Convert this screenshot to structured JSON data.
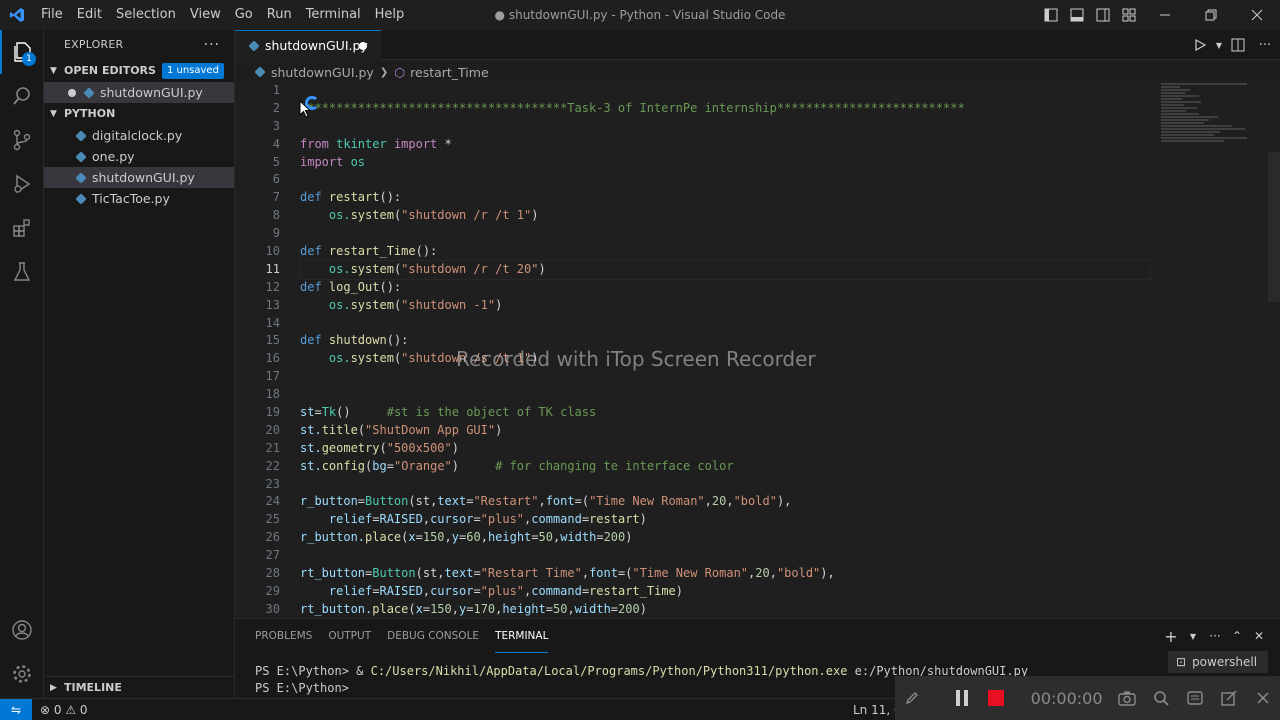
{
  "window": {
    "title": "● shutdownGUI.py - Python - Visual Studio Code",
    "menu": [
      "File",
      "Edit",
      "Selection",
      "View",
      "Go",
      "Run",
      "Terminal",
      "Help"
    ]
  },
  "activity_bar": {
    "items": [
      "explorer-icon",
      "search-icon",
      "source-control-icon",
      "run-debug-icon",
      "extensions-icon",
      "testing-icon"
    ],
    "bottom": [
      "account-icon",
      "settings-gear-icon"
    ],
    "explorer_badge": "1"
  },
  "sidebar": {
    "title": "EXPLORER",
    "more": "···",
    "open_editors": {
      "label": "OPEN EDITORS",
      "badge": "1 unsaved",
      "files": [
        "shutdownGUI.py"
      ]
    },
    "folder": {
      "label": "PYTHON",
      "files": [
        "digitalclock.py",
        "one.py",
        "shutdownGUI.py",
        "TicTacToe.py"
      ]
    },
    "timeline": "TIMELINE"
  },
  "editor": {
    "tab": "shutdownGUI.py",
    "breadcrumb": [
      "shutdownGUI.py",
      "restart_Time"
    ],
    "line_numbers": [
      "1",
      "2",
      "3",
      "4",
      "5",
      "6",
      "7",
      "8",
      "9",
      "10",
      "11",
      "12",
      "13",
      "14",
      "15",
      "16",
      "17",
      "18",
      "19",
      "20",
      "21",
      "22",
      "23",
      "24",
      "25",
      "26",
      "27",
      "28",
      "29",
      "30"
    ],
    "current_line": "11",
    "code": {
      "l2": "*************************************Task-3 of InternPe internship**************************",
      "l4a": "from",
      "l4b": " tkinter ",
      "l4c": "import",
      "l4d": " *",
      "l5a": "import",
      "l5b": " os",
      "l7a": "def",
      "l7b": " restart",
      "l7c": "():",
      "l8a": "    os.",
      "l8b": "system",
      "l8c": "(",
      "l8d": "\"shutdown /r /t 1\"",
      "l8e": ")",
      "l10a": "def",
      "l10b": " restart_Time",
      "l10c": "():",
      "l11a": "    os.",
      "l11b": "system",
      "l11c": "(",
      "l11d": "\"shutdown /r /t 20\"",
      "l11e": ")",
      "l12a": "def",
      "l12b": " log_Out",
      "l12c": "():",
      "l13a": "    os.",
      "l13b": "system",
      "l13c": "(",
      "l13d": "\"shutdown -1\"",
      "l13e": ")",
      "l15a": "def",
      "l15b": " shutdown",
      "l15c": "():",
      "l16a": "    os.",
      "l16b": "system",
      "l16c": "(",
      "l16d": "\"shutdown /s /t 1\"",
      "l16e": ")",
      "l19a": "st",
      "l19b": "=",
      "l19c": "Tk",
      "l19d": "()     ",
      "l19e": "#st is the object of TK class",
      "l20a": "st.",
      "l20b": "title",
      "l20c": "(",
      "l20d": "\"ShutDown App GUI\"",
      "l20e": ")",
      "l21a": "st.",
      "l21b": "geometry",
      "l21c": "(",
      "l21d": "\"500x500\"",
      "l21e": ")",
      "l22a": "st.",
      "l22b": "config",
      "l22c": "(",
      "l22d": "bg",
      "l22e": "=",
      "l22f": "\"Orange\"",
      "l22g": ")     ",
      "l22h": "# for changing te interface color",
      "l24a": "r_button",
      "l24b": "=",
      "l24c": "Button",
      "l24d": "(st,",
      "l24e": "text",
      "l24f": "=",
      "l24g": "\"Restart\"",
      "l24h": ",",
      "l24i": "font",
      "l24j": "=(",
      "l24k": "\"Time New Roman\"",
      "l24l": ",",
      "l24m": "20",
      "l24n": ",",
      "l24o": "\"bold\"",
      "l24p": "),",
      "l25a": "    relief",
      "l25b": "=",
      "l25c": "RAISED",
      "l25d": ",",
      "l25e": "cursor",
      "l25f": "=",
      "l25g": "\"plus\"",
      "l25h": ",",
      "l25i": "command",
      "l25j": "=",
      "l25k": "restart",
      "l25l": ")",
      "l26a": "r_button.",
      "l26b": "place",
      "l26c": "(",
      "l26d": "x",
      "l26e": "=",
      "l26f": "150",
      "l26g": ",",
      "l26h": "y",
      "l26i": "=",
      "l26j": "60",
      "l26k": ",",
      "l26l": "height",
      "l26m": "=",
      "l26n": "50",
      "l26o": ",",
      "l26p": "width",
      "l26q": "=",
      "l26r": "200",
      "l26s": ")",
      "l28a": "rt_button",
      "l28b": "=",
      "l28c": "Button",
      "l28d": "(st,",
      "l28e": "text",
      "l28f": "=",
      "l28g": "\"Restart Time\"",
      "l28h": ",",
      "l28i": "font",
      "l28j": "=(",
      "l28k": "\"Time New Roman\"",
      "l28l": ",",
      "l28m": "20",
      "l28n": ",",
      "l28o": "\"bold\"",
      "l28p": "),",
      "l29a": "    relief",
      "l29b": "=",
      "l29c": "RAISED",
      "l29d": ",",
      "l29e": "cursor",
      "l29f": "=",
      "l29g": "\"plus\"",
      "l29h": ",",
      "l29i": "command",
      "l29j": "=",
      "l29k": "restart_Time",
      "l29l": ")",
      "l30a": "rt_button.",
      "l30b": "place",
      "l30c": "(",
      "l30d": "x",
      "l30e": "=",
      "l30f": "150",
      "l30g": ",",
      "l30h": "y",
      "l30i": "=",
      "l30j": "170",
      "l30k": ",",
      "l30l": "height",
      "l30m": "=",
      "l30n": "50",
      "l30o": ",",
      "l30p": "width",
      "l30q": "=",
      "l30r": "200",
      "l30s": ")"
    },
    "watermark": "Recorded with iTop Screen Recorder"
  },
  "panel": {
    "tabs": [
      "PROBLEMS",
      "OUTPUT",
      "DEBUG CONSOLE",
      "TERMINAL"
    ],
    "active_tab": "TERMINAL",
    "terminal_lines": {
      "line1_prompt": "PS E:\\Python> & ",
      "line1_exe": "C:/Users/Nikhil/AppData/Local/Programs/Python/Python311/python.exe",
      "line1_arg": " e:/Python/shutdownGUI.py",
      "line2": "PS E:\\Python> "
    },
    "shell": "powershell"
  },
  "statusbar": {
    "problems": "⊗ 0 ⚠ 0",
    "position": "Ln 11, C"
  },
  "recorder": {
    "time": "00:00:00"
  },
  "colors": {
    "accent": "#0078d4",
    "editor_bg": "#1f1f1f",
    "record_red": "#e81123"
  }
}
